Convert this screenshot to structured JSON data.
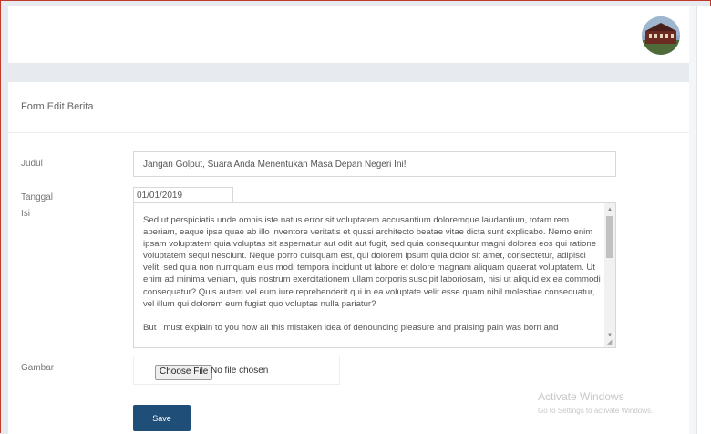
{
  "header": {
    "avatar_icon": "building-photo-icon"
  },
  "form": {
    "title": "Form Edit Berita",
    "fields": {
      "judul": {
        "label": "Judul",
        "value": "Jangan Golput, Suara Anda Menentukan Masa Depan Negeri Ini!"
      },
      "tanggal": {
        "label": "Tanggal",
        "value": "01/01/2019"
      },
      "isi": {
        "label": "Isi",
        "paragraphs": [
          "Sed ut perspiciatis unde omnis iste natus error sit voluptatem accusantium doloremque laudantium, totam rem aperiam, eaque ipsa quae ab illo inventore veritatis et quasi architecto beatae vitae dicta sunt explicabo. Nemo enim ipsam voluptatem quia voluptas sit aspernatur aut odit aut fugit, sed quia consequuntur magni dolores eos qui ratione voluptatem sequi nesciunt. Neque porro quisquam est, qui dolorem ipsum quia dolor sit amet, consectetur, adipisci velit, sed quia non numquam eius modi tempora incidunt ut labore et dolore magnam aliquam quaerat voluptatem. Ut enim ad minima veniam, quis nostrum exercitationem ullam corporis suscipit laboriosam, nisi ut aliquid ex ea commodi consequatur? Quis autem vel eum iure reprehenderit qui in ea voluptate velit esse quam nihil molestiae consequatur, vel illum qui dolorem eum fugiat quo voluptas nulla pariatur?",
          "But I must explain to you how all this mistaken idea of denouncing pleasure and praising pain was born and I"
        ]
      },
      "gambar": {
        "label": "Gambar",
        "button": "Choose File",
        "status": "No file chosen"
      }
    },
    "save_label": "Save"
  },
  "watermark": {
    "line1": "Activate Windows",
    "line2": "Go to Settings to activate Windows."
  }
}
